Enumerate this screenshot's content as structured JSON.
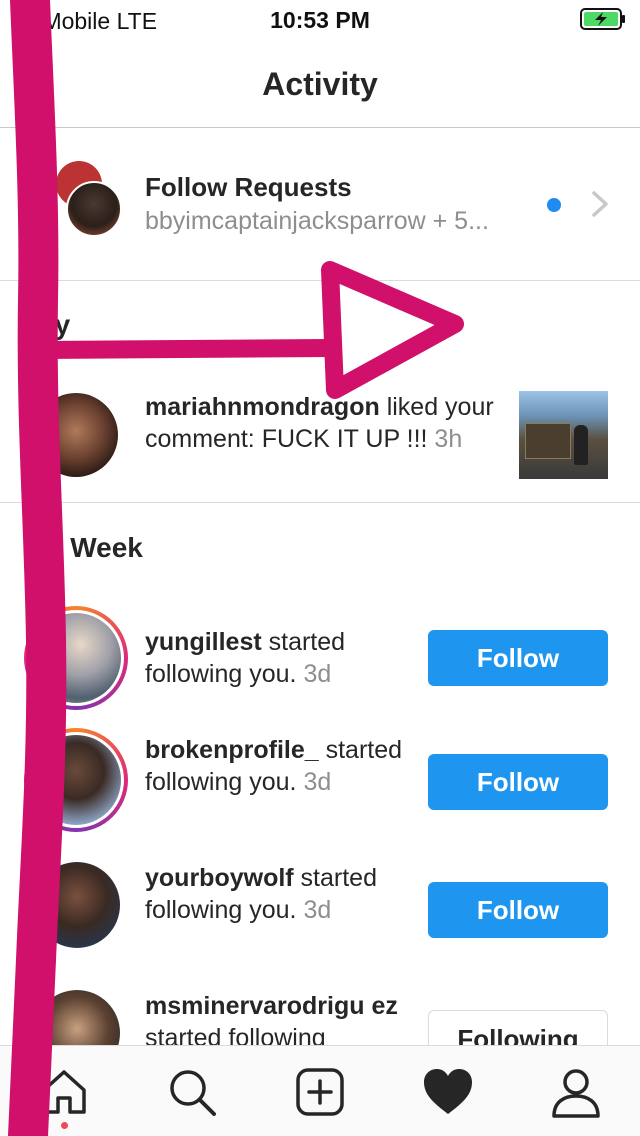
{
  "status_bar": {
    "carrier": "T-Mobile  LTE",
    "time": "10:53 PM",
    "battery_icon": "battery-charging-icon"
  },
  "header": {
    "title": "Activity"
  },
  "follow_requests": {
    "title": "Follow Requests",
    "subtitle": "bbyimcaptainjacksparrow + 5...",
    "dot_color": "#1e8cf2"
  },
  "sections": {
    "today": "day",
    "this_week": "his Week"
  },
  "today_items": [
    {
      "username": "mariahnmondragon",
      "action": " liked your comment: FUCK IT UP !!! ",
      "time": "3h"
    }
  ],
  "week_items": [
    {
      "username": "yungillest",
      "action": " started following you. ",
      "time": "3d",
      "button": "Follow"
    },
    {
      "username": "brokenprofile_",
      "action": " started following you. ",
      "time": "3d",
      "button": "Follow"
    },
    {
      "username": "yourboywolf",
      "action": " started following you. ",
      "time": "3d",
      "button": "Follow"
    },
    {
      "username": "msminervarodrigu ez",
      "action": " started following",
      "time": "",
      "button": "Following"
    }
  ],
  "tabbar": {
    "items": [
      "home-icon",
      "search-icon",
      "add-post-icon",
      "activity-heart-icon",
      "profile-icon"
    ]
  },
  "colors": {
    "accent": "#1e96f0",
    "scribble": "#d0106a",
    "notification_dot": "#ed4956"
  }
}
